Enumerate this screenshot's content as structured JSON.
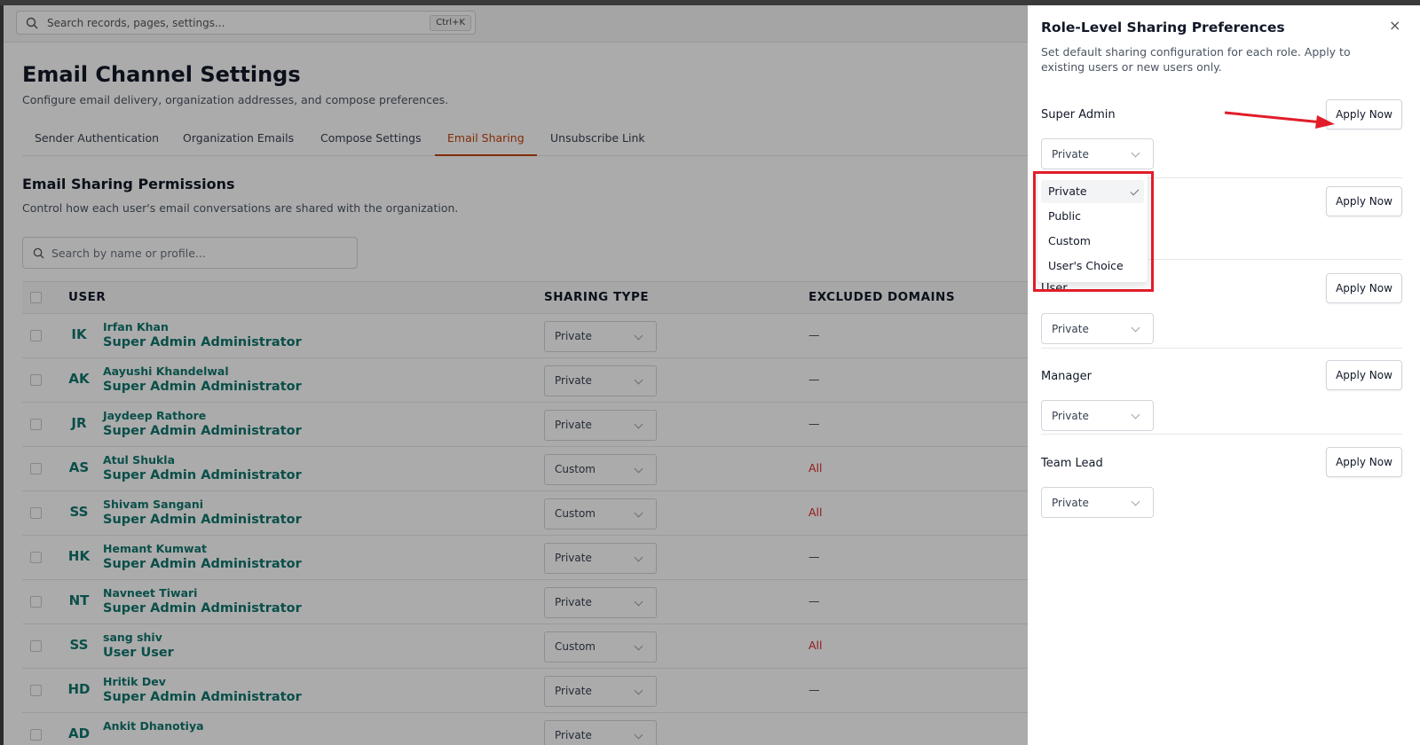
{
  "search": {
    "placeholder": "Search records, pages, settings...",
    "shortcut": "Ctrl+K"
  },
  "page": {
    "title": "Email Channel Settings",
    "subtitle": "Configure email delivery, organization addresses, and compose preferences."
  },
  "tabs": [
    {
      "label": "Sender Authentication"
    },
    {
      "label": "Organization Emails"
    },
    {
      "label": "Compose Settings"
    },
    {
      "label": "Email Sharing",
      "active": true
    },
    {
      "label": "Unsubscribe Link"
    }
  ],
  "section": {
    "title": "Email Sharing Permissions",
    "subtitle": "Control how each user's email conversations are shared with the organization.",
    "search_placeholder": "Search by name or profile..."
  },
  "table": {
    "columns": {
      "user": "USER",
      "sharing_type": "SHARING TYPE",
      "excluded_domains": "EXCLUDED DOMAINS"
    },
    "rows": [
      {
        "initials": "IK",
        "name": "Irfan Khan",
        "role": "Super Admin Administrator",
        "sharing": "Private",
        "excluded": "—"
      },
      {
        "initials": "AK",
        "name": "Aayushi Khandelwal",
        "role": "Super Admin Administrator",
        "sharing": "Private",
        "excluded": "—"
      },
      {
        "initials": "JR",
        "name": "Jaydeep Rathore",
        "role": "Super Admin Administrator",
        "sharing": "Private",
        "excluded": "—"
      },
      {
        "initials": "AS",
        "name": "Atul Shukla",
        "role": "Super Admin Administrator",
        "sharing": "Custom",
        "excluded": "All"
      },
      {
        "initials": "SS",
        "name": "Shivam Sangani",
        "role": "Super Admin Administrator",
        "sharing": "Custom",
        "excluded": "All"
      },
      {
        "initials": "HK",
        "name": "Hemant Kumwat",
        "role": "Super Admin Administrator",
        "sharing": "Private",
        "excluded": "—"
      },
      {
        "initials": "NT",
        "name": "Navneet Tiwari",
        "role": "Super Admin Administrator",
        "sharing": "Private",
        "excluded": "—"
      },
      {
        "initials": "SS",
        "name": "sang shiv",
        "role": "User User",
        "sharing": "Custom",
        "excluded": "All"
      },
      {
        "initials": "HD",
        "name": "Hritik Dev",
        "role": "Super Admin Administrator",
        "sharing": "Private",
        "excluded": "—"
      },
      {
        "initials": "AD",
        "name": "Ankit Dhanotiya",
        "role": "",
        "sharing": "Private",
        "excluded": ""
      }
    ]
  },
  "panel": {
    "title": "Role-Level Sharing Preferences",
    "close": "×",
    "description": "Set default sharing configuration for each role. Apply to existing users or new users only.",
    "apply_label": "Apply Now",
    "roles": [
      {
        "label": "Super Admin",
        "value": "Private"
      },
      {
        "label": "",
        "value": ""
      },
      {
        "label": "User",
        "value": "Private"
      },
      {
        "label": "Manager",
        "value": "Private"
      },
      {
        "label": "Team Lead",
        "value": "Private"
      }
    ]
  },
  "dropdown": {
    "options": [
      "Private",
      "Public",
      "Custom",
      "User's Choice"
    ],
    "selected": "Private"
  },
  "colors": {
    "accent": "#c2410c",
    "brand_text": "#0f766e",
    "highlight": "#e11d2a",
    "danger": "#dc2626"
  }
}
